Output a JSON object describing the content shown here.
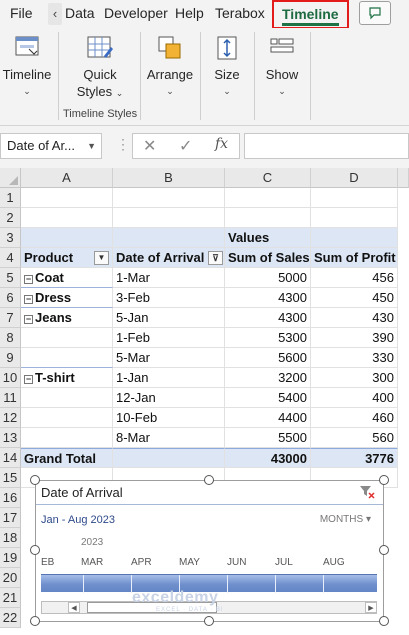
{
  "ribbon": {
    "tabs": {
      "file": "File",
      "data": "Data",
      "developer": "Developer",
      "help": "Help",
      "terabox": "Terabox",
      "timeline": "Timeline"
    },
    "buttons": {
      "timeline": "Timeline",
      "quick_styles_line1": "Quick",
      "quick_styles_line2": "Styles",
      "arrange": "Arrange",
      "size": "Size",
      "show": "Show"
    },
    "group_labels": {
      "timeline_styles": "Timeline Styles"
    }
  },
  "formula_bar": {
    "name_box": "Date of Ar...",
    "fx_label": "fx",
    "content": ""
  },
  "grid": {
    "columns": [
      "A",
      "B",
      "C",
      "D"
    ],
    "rows": [
      "1",
      "2",
      "3",
      "4",
      "5",
      "6",
      "7",
      "8",
      "9",
      "10",
      "11",
      "12",
      "13",
      "14",
      "15",
      "16",
      "17",
      "18",
      "19",
      "20",
      "21",
      "22"
    ],
    "values_label": "Values",
    "headers": {
      "product": "Product",
      "date_of_arrival": "Date of Arrival",
      "sum_of_sales": "Sum of Sales",
      "sum_of_profit": "Sum of Profit"
    },
    "data_rows": [
      {
        "product": "Coat",
        "date": "1-Mar",
        "sales": "5000",
        "profit": "456"
      },
      {
        "product": "Dress",
        "date": "3-Feb",
        "sales": "4300",
        "profit": "450"
      },
      {
        "product": "Jeans",
        "date": "5-Jan",
        "sales": "4300",
        "profit": "430"
      },
      {
        "product": "",
        "date": "1-Feb",
        "sales": "5300",
        "profit": "390"
      },
      {
        "product": "",
        "date": "5-Mar",
        "sales": "5600",
        "profit": "330"
      },
      {
        "product": "T-shirt",
        "date": "1-Jan",
        "sales": "3200",
        "profit": "300"
      },
      {
        "product": "",
        "date": "12-Jan",
        "sales": "5400",
        "profit": "400"
      },
      {
        "product": "",
        "date": "10-Feb",
        "sales": "4400",
        "profit": "460"
      },
      {
        "product": "",
        "date": "8-Mar",
        "sales": "5500",
        "profit": "560"
      }
    ],
    "grand_total": {
      "label": "Grand Total",
      "sales": "43000",
      "profit": "3776"
    }
  },
  "timeline": {
    "title": "Date of Arrival",
    "range": "Jan - Aug 2023",
    "level": "MONTHS",
    "year": "2023",
    "months": [
      "EB",
      "MAR",
      "APR",
      "MAY",
      "JUN",
      "JUL",
      "AUG"
    ]
  },
  "watermark": {
    "brand": "exceldemy",
    "tagline": "EXCEL · DATA · BI"
  },
  "colors": {
    "accent_green": "#1e7145",
    "highlight_red": "#e21b1b",
    "pivot_header": "#dce6f4",
    "timeline_bar": "#6f90cc"
  }
}
